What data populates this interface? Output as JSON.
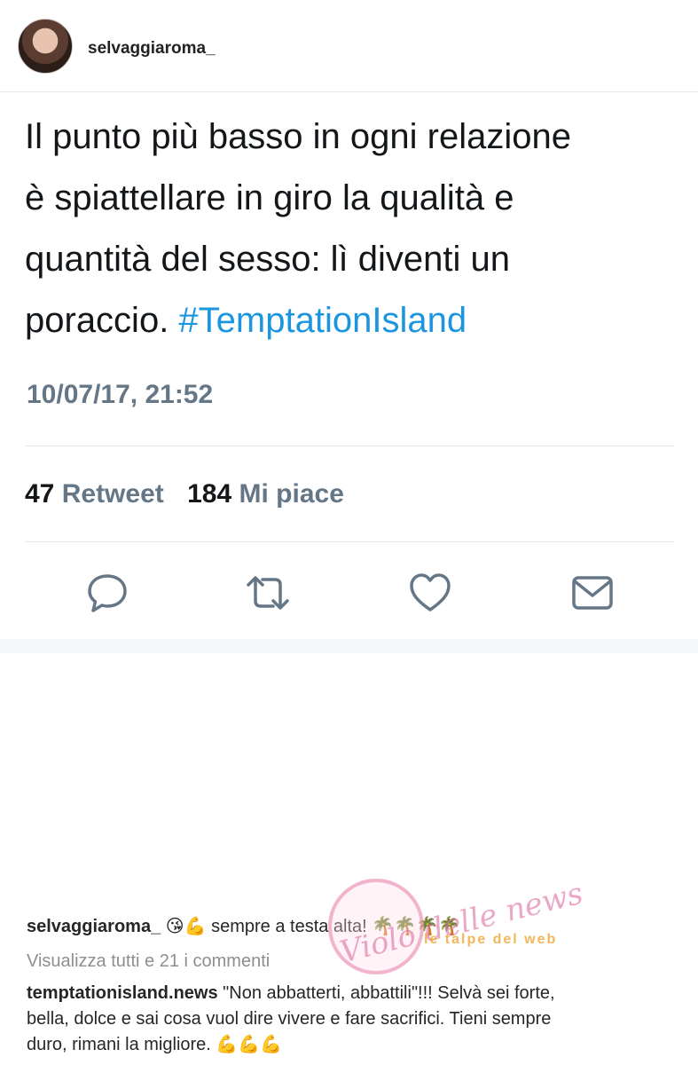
{
  "tweet": {
    "username": "selvaggiaroma_",
    "text_lines": [
      "Il punto più basso in ogni relazione",
      "è spiattellare in giro la qualità e",
      "quantità del sesso: lì diventi un",
      "poraccio. "
    ],
    "hashtag": "#TemptationIsland",
    "timestamp": "10/07/17, 21:52",
    "retweet_count": "47",
    "retweet_label": "Retweet",
    "like_count": "184",
    "like_label": "Mi piace",
    "actions": [
      "reply-icon",
      "retweet-icon",
      "heart-icon",
      "mail-icon"
    ],
    "colors": {
      "hashtag": "#1b95e0",
      "muted": "#657786",
      "icons": "#657786"
    }
  },
  "instagram": {
    "comment1_user": "selvaggiaroma_",
    "comment1_emojis": "😘💪",
    "comment1_text": "sempre a testa alta!",
    "comment1_trailing": "🌴🌴🌴🌴",
    "view_all": "Visualizza tutti e 21 i commenti",
    "comment2_user": "temptationisland.news",
    "comment2_text_1": "\"Non abbatterti, abbattili\"!!! Selvà sei forte,",
    "comment2_text_2": "bella, dolce e sai cosa vuol dire vivere e fare sacrifici. Tieni sempre",
    "comment2_text_3": "duro, rimani la migliore.",
    "comment2_emojis": "💪💪💪"
  },
  "watermark": {
    "script": "Violo delle news",
    "banner": "le talpe del web"
  }
}
